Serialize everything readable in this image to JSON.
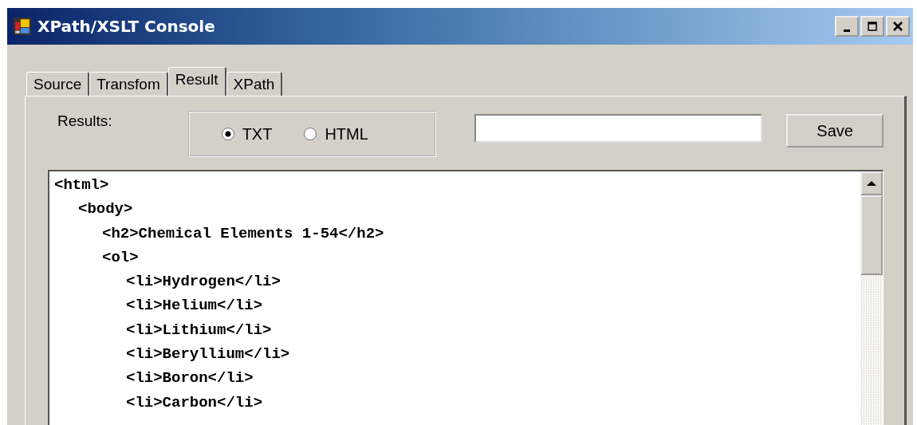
{
  "window": {
    "title": "XPath/XSLT Console"
  },
  "tabs": [
    {
      "label": "Source",
      "selected": false
    },
    {
      "label": "Transfom",
      "selected": false
    },
    {
      "label": "Result",
      "selected": true
    },
    {
      "label": "XPath",
      "selected": false
    }
  ],
  "results_label": "Results:",
  "format_options": [
    {
      "label": "TXT",
      "selected": true
    },
    {
      "label": "HTML",
      "selected": false
    }
  ],
  "save_button": "Save",
  "output": [
    {
      "text": "<html>",
      "children": [
        {
          "text": "<body>",
          "children": [
            {
              "text": "<h2>Chemical Elements 1-54</h2>"
            },
            {
              "text": "<ol>",
              "children": [
                {
                  "text": "<li>Hydrogen</li>"
                },
                {
                  "text": "<li>Helium</li>"
                },
                {
                  "text": "<li>Lithium</li>"
                },
                {
                  "text": "<li>Beryllium</li>"
                },
                {
                  "text": "<li>Boron</li>"
                },
                {
                  "text": "<li>Carbon</li>"
                }
              ]
            }
          ]
        }
      ]
    }
  ]
}
